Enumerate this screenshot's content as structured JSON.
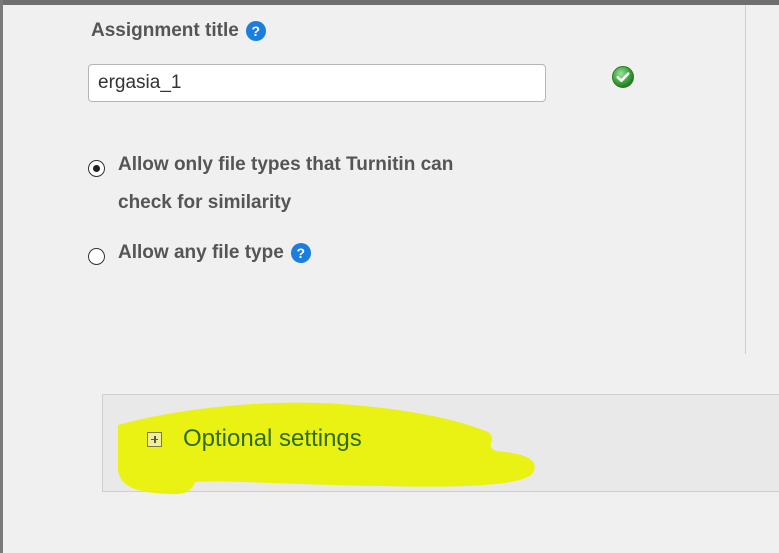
{
  "assignment": {
    "title_label": "Assignment title",
    "title_help_icon": "question-circle-icon",
    "title_value": "ergasia_1",
    "valid_icon": "check-circle-icon"
  },
  "file_types": {
    "option_restricted_line1": "Allow only file types that Turnitin can",
    "option_restricted_line2": "check for similarity",
    "option_restricted_selected": true,
    "option_any": "Allow any file type",
    "option_any_selected": false,
    "any_help_icon": "question-circle-icon"
  },
  "optional_settings": {
    "label": "Optional settings",
    "expand_icon": "plus-square-icon",
    "highlight_color": "#e8f000"
  },
  "colors": {
    "help_blue": "#1a7ee0",
    "valid_green": "#3aa33a",
    "label_gray": "#555555",
    "optional_text": "#2e6b12"
  }
}
